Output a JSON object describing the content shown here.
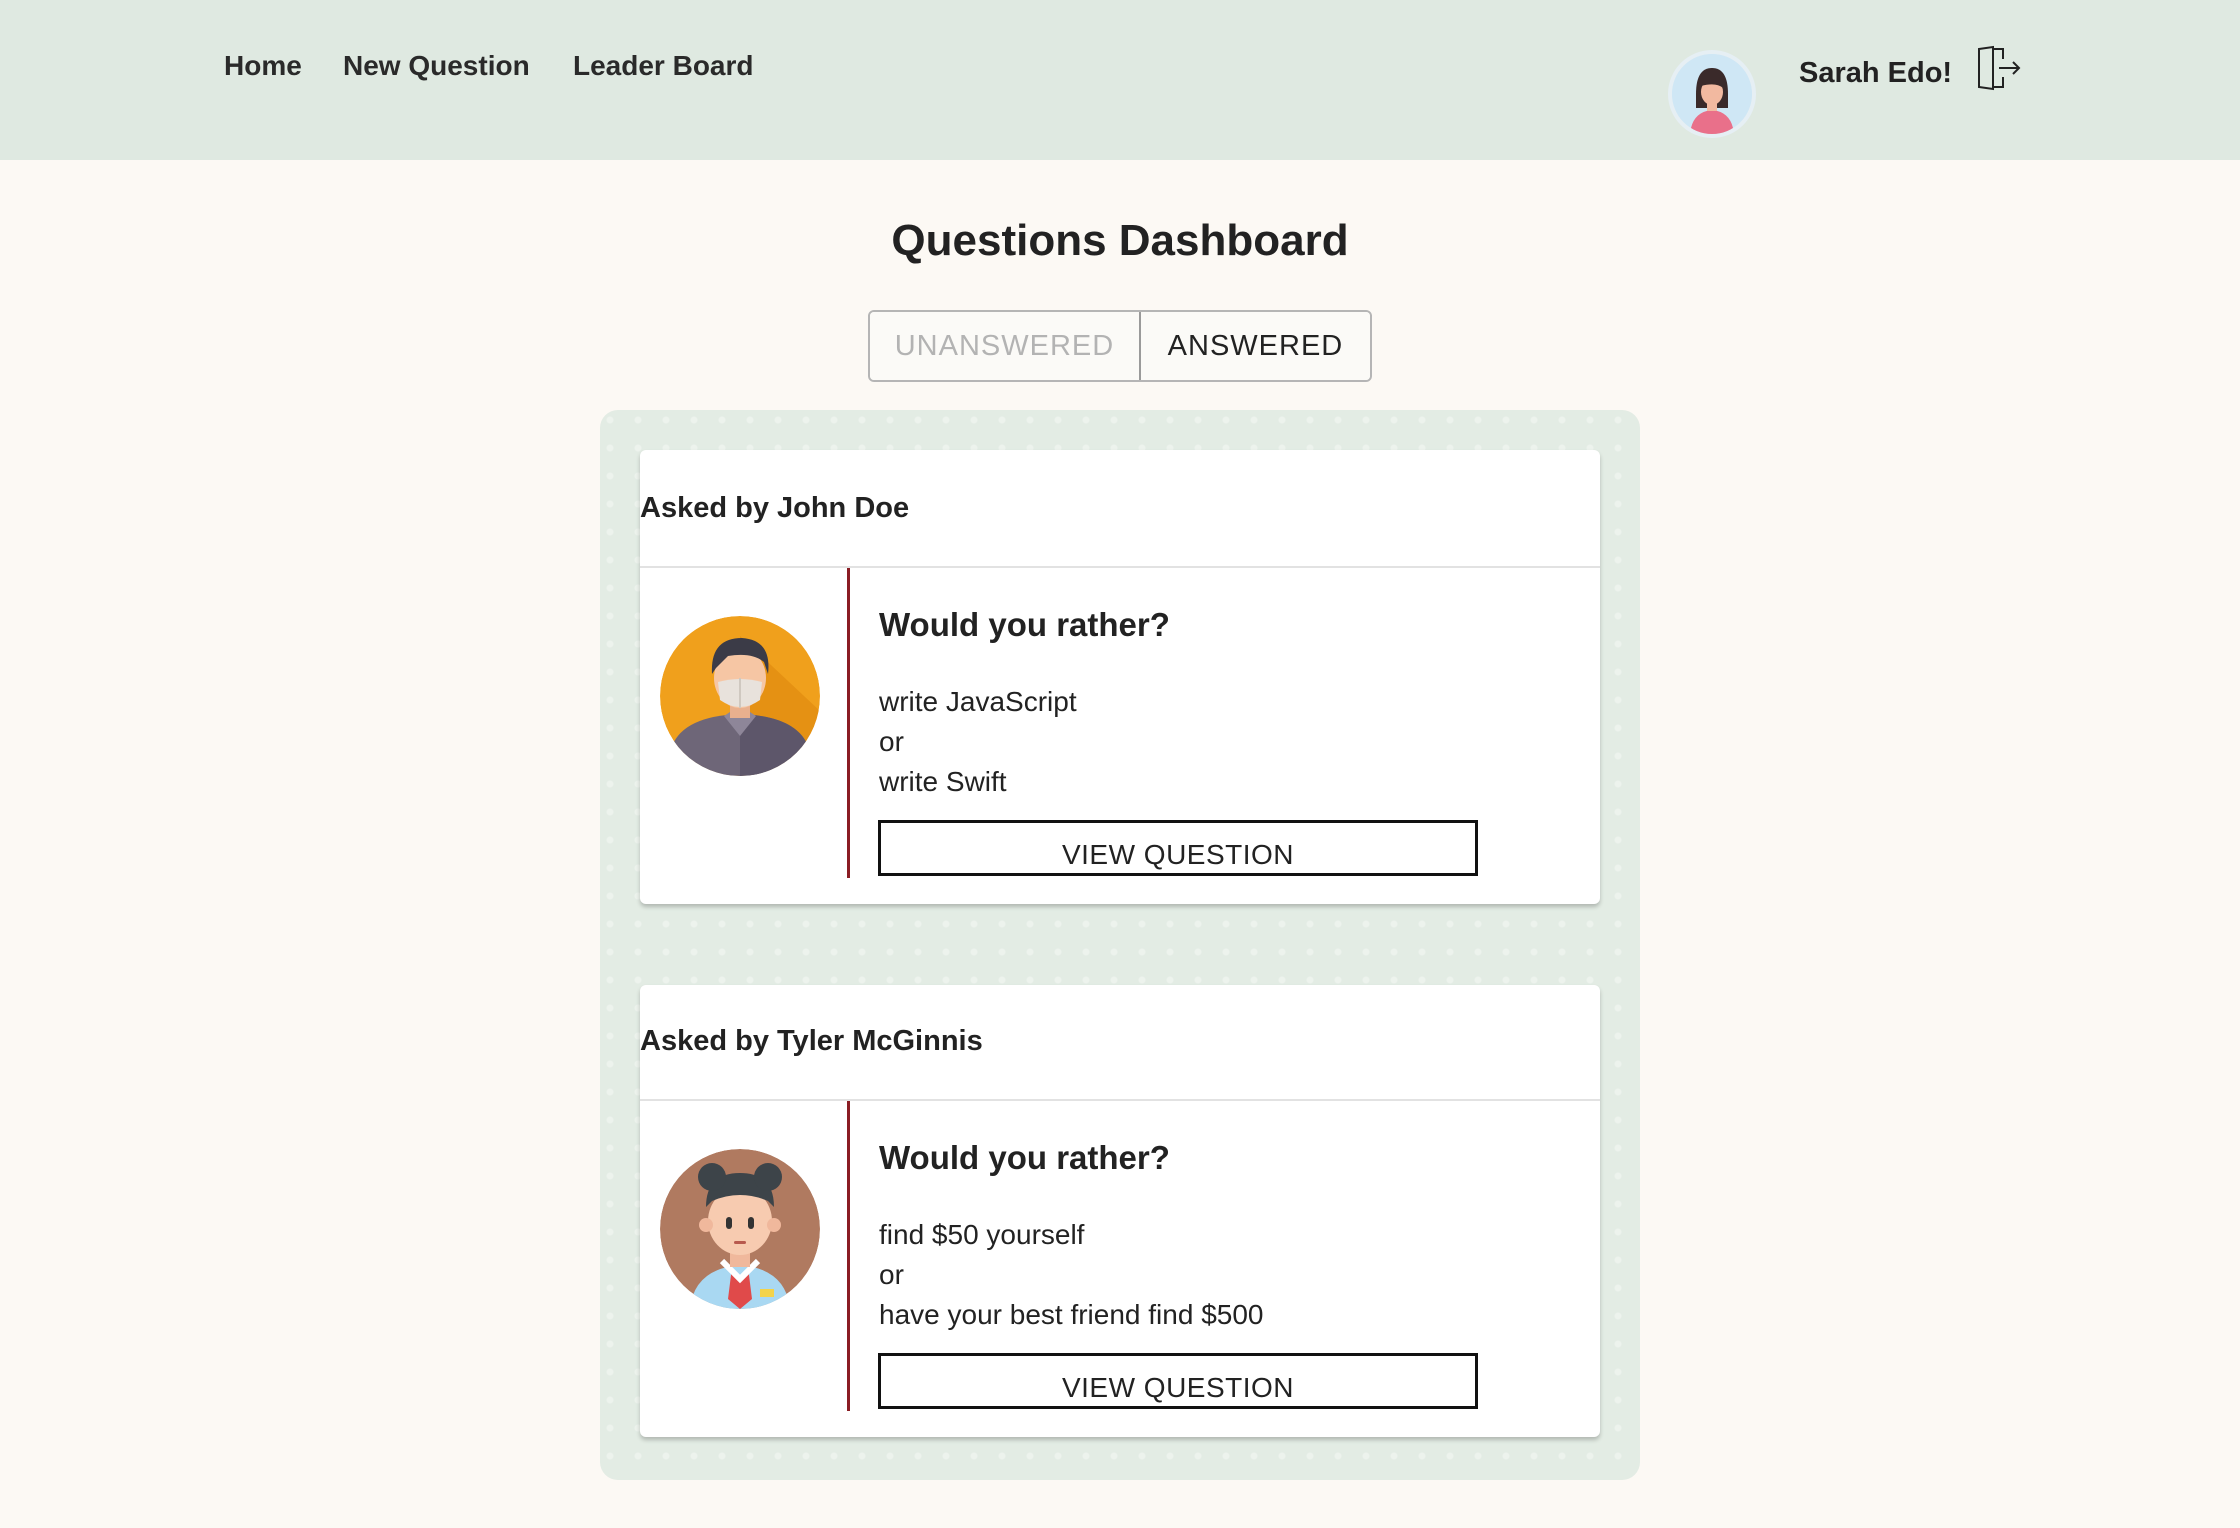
{
  "nav": {
    "links": [
      "Home",
      "New Question",
      "Leader Board"
    ],
    "username": "Sarah Edo!",
    "avatar_icon": "woman-avatar-icon",
    "logout_icon": "logout-door-icon"
  },
  "page": {
    "title": "Questions Dashboard"
  },
  "tabs": {
    "unanswered": "UNANSWERED",
    "answered": "ANSWERED",
    "active": "answered"
  },
  "questions": [
    {
      "asked_by": "Asked by John Doe",
      "heading": "Would you rather?",
      "option_one": "write JavaScript",
      "separator": "or",
      "option_two": "write Swift",
      "button": "VIEW QUESTION",
      "avatar_icon": "man-with-mask-avatar-icon"
    },
    {
      "asked_by": "Asked by Tyler McGinnis",
      "heading": "Would you rather?",
      "option_one": "find $50 yourself",
      "separator": "or",
      "option_two": "have your best friend find $500",
      "button": "VIEW QUESTION",
      "avatar_icon": "man-with-tie-avatar-icon"
    }
  ],
  "colors": {
    "nav_bg": "#dfe9e1",
    "page_bg": "#fcf9f4",
    "divider": "#8a1d24"
  }
}
